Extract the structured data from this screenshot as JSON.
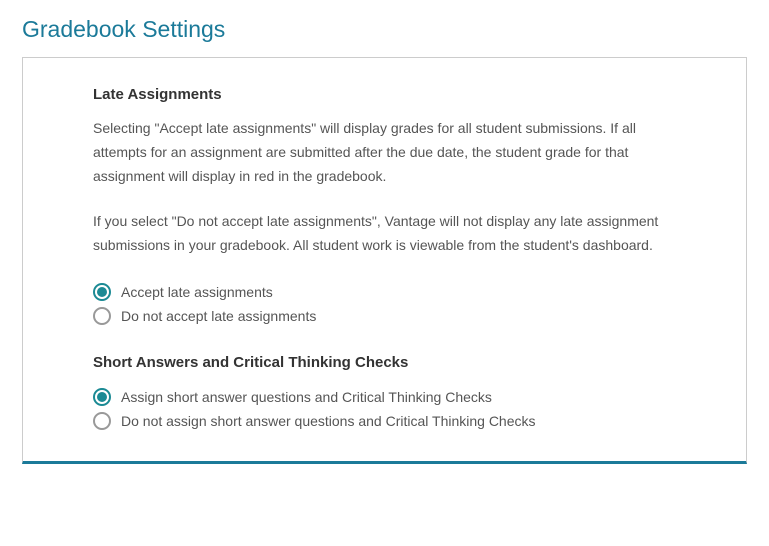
{
  "page_title": "Gradebook Settings",
  "late": {
    "heading": "Late Assignments",
    "p1": "Selecting \"Accept late assignments\" will display grades for all student submissions. If all attempts for an assignment are submitted after the due date, the student grade for that assignment will display in red in the gradebook.",
    "p2": "If you select \"Do not accept late assignments\", Vantage will not display any late assignment submissions in your gradebook. All student work is viewable from the student's dashboard.",
    "options": {
      "accept": "Accept late assignments",
      "reject": "Do not accept late assignments"
    },
    "selected": "accept"
  },
  "short": {
    "heading": "Short Answers and Critical Thinking Checks",
    "options": {
      "assign": "Assign short answer questions and Critical Thinking Checks",
      "noassign": "Do not assign short answer questions and Critical Thinking Checks"
    },
    "selected": "assign"
  },
  "colors": {
    "accent": "#1b7a99",
    "radio": "#1b8a94"
  }
}
